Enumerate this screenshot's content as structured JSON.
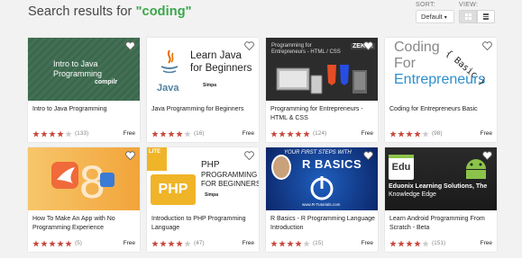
{
  "header": {
    "title_prefix": "Search results for ",
    "query": "\"coding\"",
    "sort_label": "SORT:",
    "sort_value": "Default",
    "view_label": "VIEW:",
    "view_mode": "grid"
  },
  "courses": [
    {
      "title": "Intro to Java Programming",
      "rating": 4,
      "count": "(133)",
      "price": "Free",
      "thumb": {
        "line1": "Intro to Java",
        "line2": "Programming",
        "brand": "compilr"
      }
    },
    {
      "title": "Java Programming for Beginners",
      "rating": 4,
      "count": "(16)",
      "price": "Free",
      "thumb": {
        "logo": "Java",
        "line1": "Learn Java",
        "line2": "for Beginners",
        "brand": "Simpa"
      }
    },
    {
      "title": "Programming for Entrepreneurs - HTML & CSS",
      "rating": 5,
      "count": "(124)",
      "price": "Free",
      "thumb": {
        "line1": "Programming for",
        "line2": "Entrepreneurs - HTML / CSS",
        "brand": "ZEKTA"
      }
    },
    {
      "title": "Coding for Entrepreneurs Basic",
      "rating": 4,
      "count": "(98)",
      "price": "Free",
      "thumb": {
        "line1": "Coding",
        "line2": "For",
        "line3": "Entrepreneurs",
        "tag": "{ Basic }"
      }
    },
    {
      "title": "How To Make An App with No Programming Experience",
      "rating": 5,
      "count": "(5)",
      "price": "Free",
      "thumb": {}
    },
    {
      "title": "Introduction to PHP Programming Language",
      "rating": 4,
      "count": "(47)",
      "price": "Free",
      "thumb": {
        "badge": "LITE",
        "logo": "PHP",
        "line1": "PHP",
        "line2": "PROGRAMMING",
        "line3": "FOR BEGINNERS",
        "brand": "Simpa"
      }
    },
    {
      "title": "R Basics - R Programming Language Introduction",
      "rating": 4,
      "count": "(15)",
      "price": "Free",
      "thumb": {
        "line1": "YOUR FIRST STEPS WITH",
        "line2": "R BASICS",
        "brand": "www.R-Tutorials.com"
      }
    },
    {
      "title": "Learn Android Programming From Scratch - Beta",
      "rating": 4,
      "count": "(151)",
      "price": "Free",
      "thumb": {
        "logo": "Edu",
        "line1": "Eduonix Learning Solutions, The",
        "line2": "Knowledge Edge"
      }
    }
  ],
  "colors": {
    "accent": "#3aa64b",
    "star": "#c8483d",
    "star_empty": "#cccccc"
  }
}
